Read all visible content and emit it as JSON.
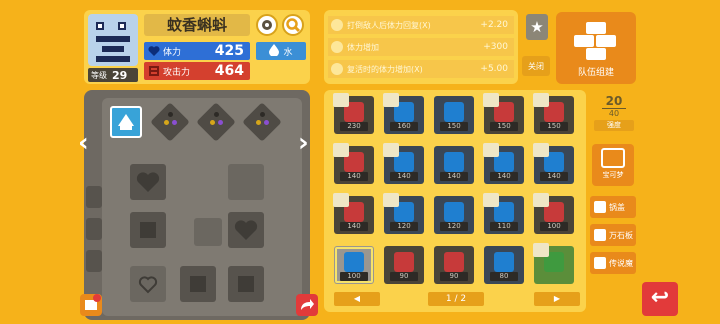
{
  "pokemon": {
    "name": "蚊香蝌蚪",
    "level_label": "等级",
    "level": "29",
    "hp_label": "体力",
    "hp": "425",
    "atk_label": "攻击力",
    "atk": "464",
    "type": "水"
  },
  "bonuses": [
    {
      "label": "打倒敌人后体力回复(X)",
      "value": "+2.20"
    },
    {
      "label": "体力增加",
      "value": "+300"
    },
    {
      "label": "复活时的体力增加(X)",
      "value": "+5.00"
    }
  ],
  "controls": {
    "close_label": "关闭",
    "team_edit_label": "队伍组建",
    "strength_label": "强度",
    "stone_box_label": "宝可梦",
    "prev_label": "◀",
    "next_label": "▶",
    "pager": "1 / 2",
    "count_current": "20",
    "count_max": "40",
    "side_buttons": [
      "锅盖",
      "万石板",
      "传说魔"
    ]
  },
  "inventory": [
    {
      "num": "230",
      "color": "#c73a3a",
      "bg": "#4a4438",
      "head": true
    },
    {
      "num": "160",
      "color": "#1f7fd0",
      "bg": "#3a4756",
      "head": true
    },
    {
      "num": "150",
      "color": "#1f7fd0",
      "bg": "#3a4756",
      "head": false
    },
    {
      "num": "150",
      "color": "#c73a3a",
      "bg": "#4a4438",
      "head": true
    },
    {
      "num": "150",
      "color": "#c73a3a",
      "bg": "#4a4438",
      "head": true
    },
    {
      "num": "140",
      "color": "#c73a3a",
      "bg": "#4a4438",
      "head": true
    },
    {
      "num": "140",
      "color": "#1f7fd0",
      "bg": "#3a4756",
      "head": true
    },
    {
      "num": "140",
      "color": "#1f7fd0",
      "bg": "#3a4756",
      "head": false
    },
    {
      "num": "140",
      "color": "#1f7fd0",
      "bg": "#3a4756",
      "head": true
    },
    {
      "num": "140",
      "color": "#1f7fd0",
      "bg": "#3a4756",
      "head": true
    },
    {
      "num": "140",
      "color": "#c73a3a",
      "bg": "#4a4438",
      "head": true
    },
    {
      "num": "120",
      "color": "#1f7fd0",
      "bg": "#3a4756",
      "head": true
    },
    {
      "num": "120",
      "color": "#1f7fd0",
      "bg": "#3a4756",
      "head": false
    },
    {
      "num": "110",
      "color": "#1f7fd0",
      "bg": "#3a4756",
      "head": true
    },
    {
      "num": "100",
      "color": "#c73a3a",
      "bg": "#4a4438",
      "head": true
    },
    {
      "num": "100",
      "color": "#1f7fd0",
      "bg": "#9a9690",
      "head": false
    },
    {
      "num": "90",
      "color": "#c73a3a",
      "bg": "#4a4438",
      "head": false
    },
    {
      "num": "90",
      "color": "#c73a3a",
      "bg": "#4a4438",
      "head": false
    },
    {
      "num": "80",
      "color": "#1f7fd0",
      "bg": "#3a4756",
      "head": false
    },
    {
      "num": "",
      "color": "#3f9a3f",
      "bg": "#5b8e3a",
      "head": true
    }
  ],
  "colors": {
    "background": "#f6b21a",
    "panel": "#fbd24b",
    "hp": "#2e6fd6",
    "attack": "#d4402e",
    "accent": "#e98a1b",
    "back": "#e23a3a"
  }
}
